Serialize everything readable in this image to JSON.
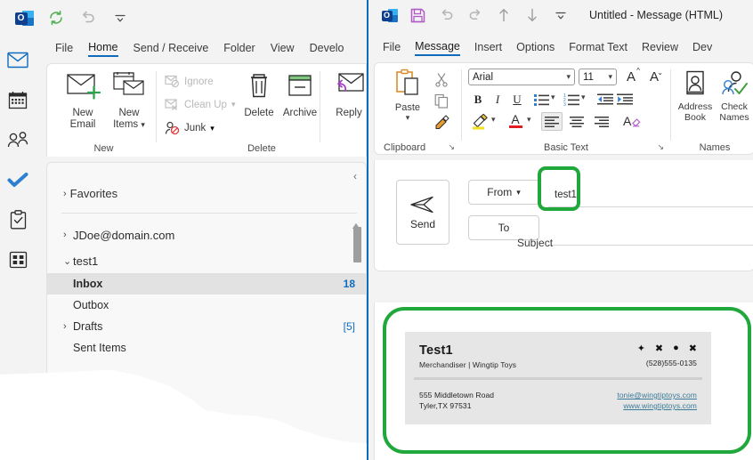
{
  "outlook": {
    "quick_access": [
      {
        "name": "outlook-logo-icon",
        "label": "Outlook"
      },
      {
        "name": "refresh-send-receive-icon",
        "label": "Send/Receive All Folders"
      },
      {
        "name": "undo-icon",
        "label": "Undo"
      },
      {
        "name": "customize-quick-access-toolbar-icon",
        "label": "Customize Quick Access Toolbar"
      }
    ],
    "tabs": [
      {
        "label": "File",
        "active": false
      },
      {
        "label": "Home",
        "active": true
      },
      {
        "label": "Send / Receive",
        "active": false
      },
      {
        "label": "Folder",
        "active": false
      },
      {
        "label": "View",
        "active": false
      },
      {
        "label": "Develo",
        "active": false
      }
    ],
    "rail": [
      {
        "name": "mail-icon",
        "label": "Mail",
        "selected": true
      },
      {
        "name": "calendar-icon",
        "label": "Calendar",
        "selected": false
      },
      {
        "name": "people-icon",
        "label": "People",
        "selected": false
      },
      {
        "name": "todo-check-icon",
        "label": "To Do",
        "selected": false
      },
      {
        "name": "tasks-clipboard-icon",
        "label": "Tasks",
        "selected": false
      },
      {
        "name": "more-apps-icon",
        "label": "More Apps",
        "selected": false
      }
    ],
    "ribbon": {
      "groups": [
        {
          "name": "New",
          "label": "New"
        },
        {
          "name": "Delete",
          "label": "Delete"
        }
      ],
      "new_email": {
        "line1": "New",
        "line2": "Email"
      },
      "new_items": {
        "line1": "New",
        "line2": "Items"
      },
      "ignore": "Ignore",
      "clean_up": "Clean Up",
      "junk": "Junk",
      "delete": "Delete",
      "archive": "Archive",
      "reply": "Reply"
    },
    "folder_pane": {
      "collapse_label": "‹",
      "favorites": "Favorites",
      "items": [
        {
          "label": "JDoe@domain.com",
          "count": "",
          "expander": "›",
          "indent": false,
          "selected": false,
          "bold": false
        },
        {
          "label": "test1",
          "count": "",
          "expander": "⌄",
          "indent": false,
          "selected": false,
          "bold": false
        },
        {
          "label": "Inbox",
          "count": "18",
          "expander": "",
          "indent": true,
          "selected": true,
          "bold": true
        },
        {
          "label": "Outbox",
          "count": "",
          "expander": "",
          "indent": true,
          "selected": false,
          "bold": false
        },
        {
          "label": "Drafts",
          "count": "[5]",
          "expander": "›",
          "indent": false,
          "selected": false,
          "bold": false
        },
        {
          "label": "Sent Items",
          "count": "",
          "expander": "",
          "indent": true,
          "selected": false,
          "bold": false
        }
      ]
    }
  },
  "message_window": {
    "title": "Untitled  -  Message (HTML)",
    "quick_access": [
      {
        "name": "outlook-logo-icon",
        "label": "Outlook"
      },
      {
        "name": "save-icon",
        "label": "Save"
      },
      {
        "name": "undo-icon",
        "label": "Undo"
      },
      {
        "name": "redo-icon",
        "label": "Redo"
      },
      {
        "name": "previous-item-icon",
        "label": "Previous Item"
      },
      {
        "name": "next-item-icon",
        "label": "Next Item"
      },
      {
        "name": "customize-quick-access-toolbar-icon",
        "label": "Customize Quick Access Toolbar"
      }
    ],
    "tabs": [
      {
        "label": "File",
        "active": false
      },
      {
        "label": "Message",
        "active": true
      },
      {
        "label": "Insert",
        "active": false
      },
      {
        "label": "Options",
        "active": false
      },
      {
        "label": "Format Text",
        "active": false
      },
      {
        "label": "Review",
        "active": false
      },
      {
        "label": "Dev",
        "active": false
      }
    ],
    "ribbon": {
      "clipboard": {
        "label": "Clipboard",
        "paste": "Paste",
        "cut": "Cut",
        "copy": "Copy",
        "format_painter": "Format Painter",
        "dialog_launcher": "↘"
      },
      "basic_text": {
        "label": "Basic Text",
        "font_family": "Arial",
        "font_size": "11",
        "grow_font": "A",
        "shrink_font": "A",
        "bold": "B",
        "italic": "I",
        "underline": "U",
        "bullets": "Bullets",
        "numbering": "Numbering",
        "decrease_indent": "Decrease Indent",
        "increase_indent": "Increase Indent",
        "text_highlight": "Text Highlight Color",
        "font_color": "A",
        "align_left": "Align Left",
        "align_center": "Center",
        "align_right": "Align Right",
        "clear_formatting": "Clear All Formatting",
        "dialog_launcher": "↘"
      },
      "names": {
        "label": "Names",
        "address_book": {
          "line1": "Address",
          "line2": "Book"
        },
        "check_names": {
          "line1": "Check",
          "line2": "Names"
        }
      }
    },
    "compose": {
      "send_label": "Send",
      "from_label": "From",
      "from_chevron": "⌄",
      "from_value": "test1",
      "to_label": "To",
      "to_value": "",
      "subject_label": "Subject",
      "subject_value": ""
    },
    "signature": {
      "name": "Test1",
      "role": "Merchandiser | Wingtip Toys",
      "phone": "(528)555-0135",
      "address_line1": "555 Middletown Road",
      "address_line2": "Tyler,TX 97531",
      "email": "tonie@wingtiptoys.com",
      "website": "www.wingtiptoys.com",
      "social_icons": [
        "✦",
        "✖",
        "●",
        "✖"
      ]
    }
  },
  "highlights": {
    "color": "#21a83c",
    "regions": [
      "from-value-field",
      "signature-card"
    ]
  }
}
